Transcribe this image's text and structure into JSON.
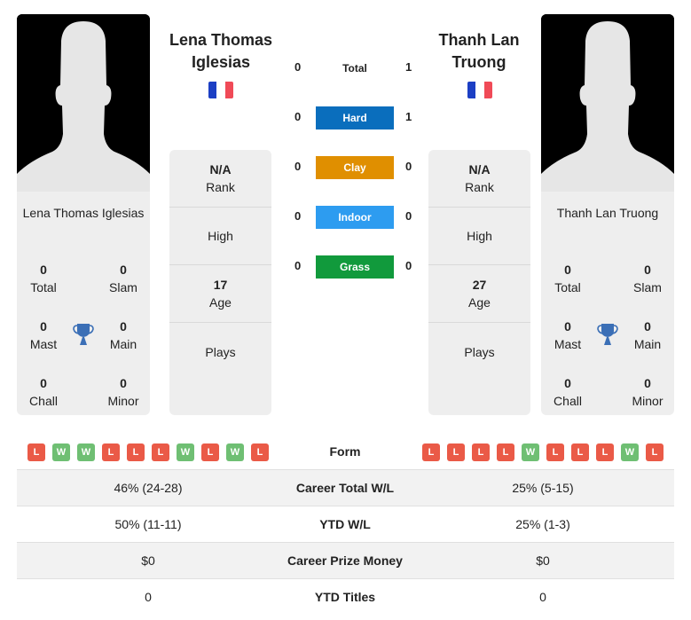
{
  "colors": {
    "hard": "#0a6ebd",
    "clay": "#e08f00",
    "indoor": "#2d9cf0",
    "grass": "#119a3c",
    "loss": "#ea5a47",
    "win": "#6fbf73",
    "trophy": "#3b6fb6"
  },
  "player1": {
    "name": "Lena Thomas Iglesias",
    "card_name": "Lena Thomas Iglesias",
    "flag": "france-flag",
    "titles": {
      "total": {
        "value": "0",
        "label": "Total"
      },
      "slam": {
        "value": "0",
        "label": "Slam"
      },
      "mast": {
        "value": "0",
        "label": "Mast"
      },
      "main": {
        "value": "0",
        "label": "Main"
      },
      "chall": {
        "value": "0",
        "label": "Chall"
      },
      "minor": {
        "value": "0",
        "label": "Minor"
      }
    },
    "info": {
      "rank": {
        "value": "N/A",
        "label": "Rank"
      },
      "high": {
        "label": "High"
      },
      "age": {
        "value": "17",
        "label": "Age"
      },
      "plays": {
        "label": "Plays"
      }
    },
    "form": [
      "L",
      "W",
      "W",
      "L",
      "L",
      "L",
      "W",
      "L",
      "W",
      "L"
    ]
  },
  "player2": {
    "name": "Thanh Lan Truong",
    "card_name": "Thanh Lan Truong",
    "flag": "france-flag",
    "titles": {
      "total": {
        "value": "0",
        "label": "Total"
      },
      "slam": {
        "value": "0",
        "label": "Slam"
      },
      "mast": {
        "value": "0",
        "label": "Mast"
      },
      "main": {
        "value": "0",
        "label": "Main"
      },
      "chall": {
        "value": "0",
        "label": "Chall"
      },
      "minor": {
        "value": "0",
        "label": "Minor"
      }
    },
    "info": {
      "rank": {
        "value": "N/A",
        "label": "Rank"
      },
      "high": {
        "label": "High"
      },
      "age": {
        "value": "27",
        "label": "Age"
      },
      "plays": {
        "label": "Plays"
      }
    },
    "form": [
      "L",
      "L",
      "L",
      "L",
      "W",
      "L",
      "L",
      "L",
      "W",
      "L"
    ]
  },
  "h2h": [
    {
      "label": "Total",
      "left": "0",
      "right": "1",
      "surface": "total"
    },
    {
      "label": "Hard",
      "left": "0",
      "right": "1",
      "surface": "hard"
    },
    {
      "label": "Clay",
      "left": "0",
      "right": "0",
      "surface": "clay"
    },
    {
      "label": "Indoor",
      "left": "0",
      "right": "0",
      "surface": "indoor"
    },
    {
      "label": "Grass",
      "left": "0",
      "right": "0",
      "surface": "grass"
    }
  ],
  "form_label": "Form",
  "stats": [
    {
      "label": "Career Total W/L",
      "left": "46% (24-28)",
      "right": "25% (5-15)"
    },
    {
      "label": "YTD W/L",
      "left": "50% (11-11)",
      "right": "25% (1-3)"
    },
    {
      "label": "Career Prize Money",
      "left": "$0",
      "right": "$0"
    },
    {
      "label": "YTD Titles",
      "left": "0",
      "right": "0"
    }
  ]
}
